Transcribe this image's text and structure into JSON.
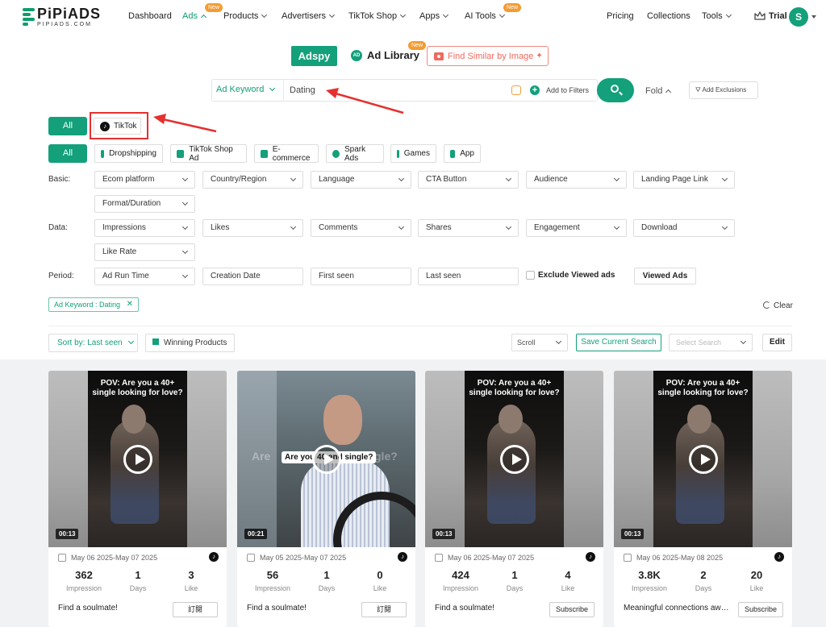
{
  "brand": {
    "name": "PiPiADS",
    "sub": "PIPIADS.COM"
  },
  "nav": {
    "items": [
      {
        "label": "Dashboard"
      },
      {
        "label": "Ads",
        "badge": "New"
      },
      {
        "label": "Products"
      },
      {
        "label": "Advertisers"
      },
      {
        "label": "TikTok Shop"
      },
      {
        "label": "Apps"
      },
      {
        "label": "AI Tools",
        "badge": "New"
      }
    ],
    "right": [
      {
        "label": "Pricing"
      },
      {
        "label": "Collections"
      },
      {
        "label": "Tools"
      }
    ],
    "trial": "Trial",
    "avatar": "S"
  },
  "modes": {
    "adspy": "Adspy",
    "ad_library": "Ad Library",
    "ad_library_badge": "New",
    "find_similar": "Find Similar by Image"
  },
  "search": {
    "type": "Ad Keyword",
    "value": "Dating",
    "add_filters": "Add to Filters",
    "fold": "Fold",
    "add_exclusions": "Add Exclusions"
  },
  "platforms": {
    "all": "All",
    "tiktok": "TikTok"
  },
  "categories": [
    "All",
    "Dropshipping",
    "TikTok Shop Ad",
    "E-commerce",
    "Spark Ads",
    "Games",
    "App"
  ],
  "filters": {
    "basic_label": "Basic:",
    "basic": [
      "Ecom platform",
      "Country/Region",
      "Language",
      "CTA Button",
      "Audience",
      "Landing Page Link",
      "Format/Duration"
    ],
    "data_label": "Data:",
    "data": [
      "Impressions",
      "Likes",
      "Comments",
      "Shares",
      "Engagement",
      "Download",
      "Like Rate"
    ],
    "period_label": "Period:",
    "period": [
      "Ad Run Time",
      "Creation Date",
      "First seen",
      "Last seen"
    ],
    "exclude_viewed": "Exclude Viewed ads",
    "viewed_ads": "Viewed Ads"
  },
  "active_chip": "Ad Keyword : Dating",
  "clear": "Clear",
  "toolbar": {
    "sort": "Sort by: Last seen",
    "winning": "Winning Products",
    "scroll": "Scroll",
    "save": "Save Current Search",
    "select_search": "Select Search",
    "edit": "Edit"
  },
  "cards": [
    {
      "caption": "POV: Are you a 40+ single looking for love?",
      "duration": "00:13",
      "date": "May 06 2025-May 07 2025",
      "impression": "362",
      "days": "1",
      "like": "3",
      "desc": "Find a soulmate!",
      "cta": "訂閱"
    },
    {
      "caption": "Are you 40 and single?",
      "ghost": "Are",
      "ghost2": "gle?",
      "duration": "00:21",
      "date": "May 05 2025-May 07 2025",
      "impression": "56",
      "days": "1",
      "like": "0",
      "desc": "Find a soulmate!",
      "cta": "訂閱"
    },
    {
      "caption": "POV: Are you a 40+ single looking for love?",
      "duration": "00:13",
      "date": "May 06 2025-May 07 2025",
      "impression": "424",
      "days": "1",
      "like": "4",
      "desc": "Find a soulmate!",
      "cta": "Subscribe"
    },
    {
      "caption": "POV: Are you a 40+ single looking for love?",
      "duration": "00:13",
      "date": "May 06 2025-May 08 2025",
      "impression": "3.8K",
      "days": "2",
      "like": "20",
      "desc": "Meaningful connections await...",
      "cta": "Subscribe"
    }
  ],
  "stat_labels": {
    "impression": "Impression",
    "days": "Days",
    "like": "Like"
  },
  "colors": {
    "accent": "#13a07a",
    "highlight": "#e53030",
    "new_badge": "#f39c34"
  }
}
